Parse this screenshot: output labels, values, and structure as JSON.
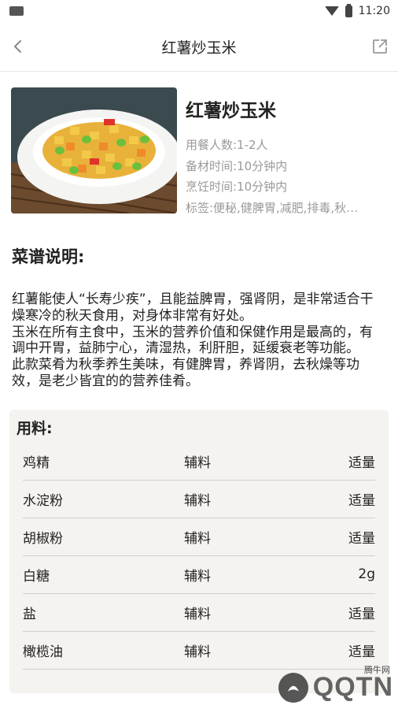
{
  "status_bar": {
    "time": "11:20"
  },
  "nav": {
    "title": "红薯炒玉米"
  },
  "recipe": {
    "title": "红薯炒玉米",
    "servings": "用餐人数:1-2人",
    "prep_time": "备材时间:10分钟内",
    "cook_time": "烹饪时间:10分钟内",
    "tags": "标签:便秘,健脾胃,减肥,排毒,秋…"
  },
  "description": {
    "heading": "菜谱说明:",
    "paragraphs": [
      "红薯能使人“长寿少疾”，且能益脾胃，强肾阴，是非常适合干燥寒冷的秋天食用，对身体非常有好处。",
      "玉米在所有主食中，玉米的营养价值和保健作用是最高的，有调中开胃，益肺宁心，清湿热，利肝胆，延缓衰老等功能。",
      "此款菜肴为秋季养生美味，有健脾胃，养肾阴，去秋燥等功效，是老少皆宜的的营养佳肴。"
    ]
  },
  "ingredients": {
    "heading": "用料:",
    "rows": [
      {
        "name": "鸡精",
        "type": "辅料",
        "amount": "适量"
      },
      {
        "name": "水淀粉",
        "type": "辅料",
        "amount": "适量"
      },
      {
        "name": "胡椒粉",
        "type": "辅料",
        "amount": "适量"
      },
      {
        "name": "白糖",
        "type": "辅料",
        "amount": "2g"
      },
      {
        "name": "盐",
        "type": "辅料",
        "amount": "适量"
      },
      {
        "name": "橄榄油",
        "type": "辅料",
        "amount": "适量"
      }
    ]
  },
  "watermark": {
    "text": "QQTN",
    "site": "腾牛网"
  },
  "icons": {
    "back": "chevron-left-icon",
    "share": "share-icon",
    "wifi": "wifi-icon",
    "battery": "battery-icon"
  }
}
